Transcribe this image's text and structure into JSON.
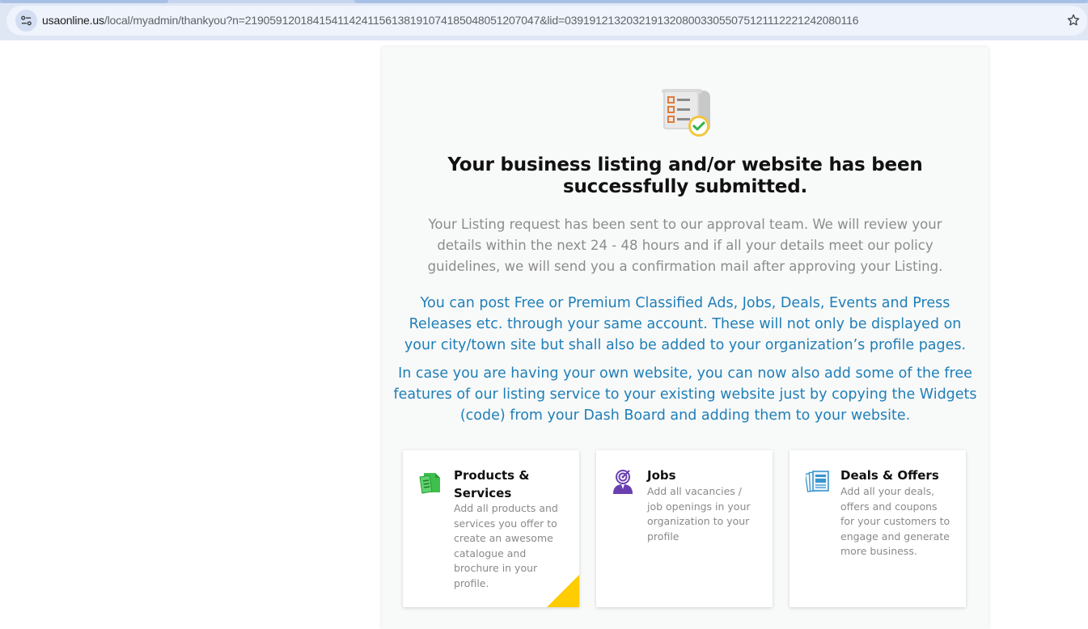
{
  "browser": {
    "url_host": "usaonline.us",
    "url_path": "/local/myadmin/thankyou?n=21905912018415411424115613819107418504805120704​7&lid=0391912132032191320800330550751211122212420801​16",
    "icons": [
      "site-info-icon",
      "bookmark-star-icon"
    ]
  },
  "thankyou": {
    "icon": "listing-checklist-icon",
    "title": "Your business listing and/or website has been successfully submitted.",
    "description": "Your Listing request has been sent to our approval team. We will review your details within the next 24 - 48 hours and if all your details meet our policy guidelines, we will send you a confirmation mail after approving your Listing.",
    "promo_1": "You can post Free or Premium Classified Ads, Jobs, Deals, Events and Press Releases etc. through your same account. These will not only be displayed on your city/town site but shall also be added to your organization’s profile pages.",
    "promo_2": "In case you are having your own website, you can now also add some of the free features of our listing service to your existing website just by copying the Widgets (code) from your Dash Board and adding them to your website."
  },
  "features": [
    {
      "icon": "products-box-icon",
      "title": "Products & Services",
      "text": "Add all products and services you offer to create an awesome catalogue and brochure in your profile."
    },
    {
      "icon": "jobs-person-target-icon",
      "title": "Jobs",
      "text": "Add all vacancies / job openings in your organization to your profile"
    },
    {
      "icon": "deals-documents-icon",
      "title": "Deals & Offers",
      "text": "Add all your deals, offers and coupons for your customers to engage and generate more business."
    }
  ],
  "colors": {
    "promo_blue": "#1f7fb7",
    "muted_gray": "#8c8c8c",
    "corner_yellow": "#ffcc00",
    "chrome_bg": "#dfe7f5"
  }
}
